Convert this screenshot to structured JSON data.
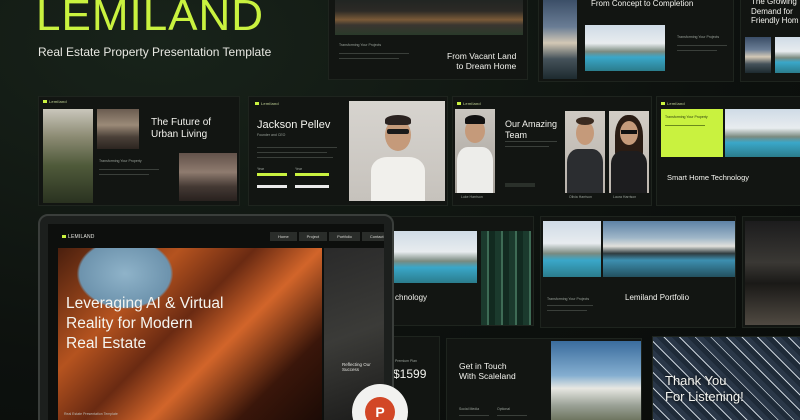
{
  "hero": {
    "brand": "LEMILAND",
    "tagline": "Real Estate Property Presentation Template"
  },
  "slides": {
    "vacant": {
      "heading": "From Vacant Land\nto Dream Home",
      "small": "Transforming Your Projects"
    },
    "concept": {
      "heading": "From Concept to Completion",
      "small": "Transforming Your Projects"
    },
    "growing": {
      "heading": "The Growing\nDemand for\nFriendly Hom"
    },
    "future": {
      "logo": "Lemiland",
      "heading": "The Future of\nUrban Living",
      "small": "Transforming Your Property"
    },
    "profile": {
      "logo": "Lemiland",
      "name": "Jackson Pellev",
      "role": "Founder and CEO",
      "stat1": "Year",
      "stat2": "Year"
    },
    "team": {
      "logo": "Lemiland",
      "heading": "Our Amazing\nTeam",
      "member1": "Luke Harrison",
      "member2": "Olivia Harrison",
      "member3": "Laura Harrison"
    },
    "smart": {
      "logo": "Lemiland",
      "heading": "Smart Home Technology",
      "small": "Transforming Your Property"
    },
    "technology": {
      "heading": "chnology"
    },
    "portfolio": {
      "heading": "Lemiland Portfolio",
      "small": "Transforming Your Projects"
    },
    "price": {
      "amount": "$1599",
      "label": "Premium Plan"
    },
    "touch": {
      "heading": "Get in Touch\nWith Scaleland",
      "f1": "Social Media",
      "f2": "Optional"
    },
    "thanks": {
      "heading": "Thank You\nFor Listening!"
    }
  },
  "laptop": {
    "logo": "LEMILAND",
    "nav": [
      "Home",
      "Project",
      "Portfolio",
      "Contact"
    ],
    "headline": "Leveraging AI & Virtual\nReality for Modern\nReal Estate",
    "side_caption": "Reflecting Our\nSuccess",
    "footer": "Real Estate Presentation Template"
  },
  "badge": {
    "icon": "powerpoint-icon",
    "letter": "P"
  },
  "colors": {
    "accent": "#c9f23f",
    "background": "#0f1410",
    "badge": "#d24726"
  }
}
